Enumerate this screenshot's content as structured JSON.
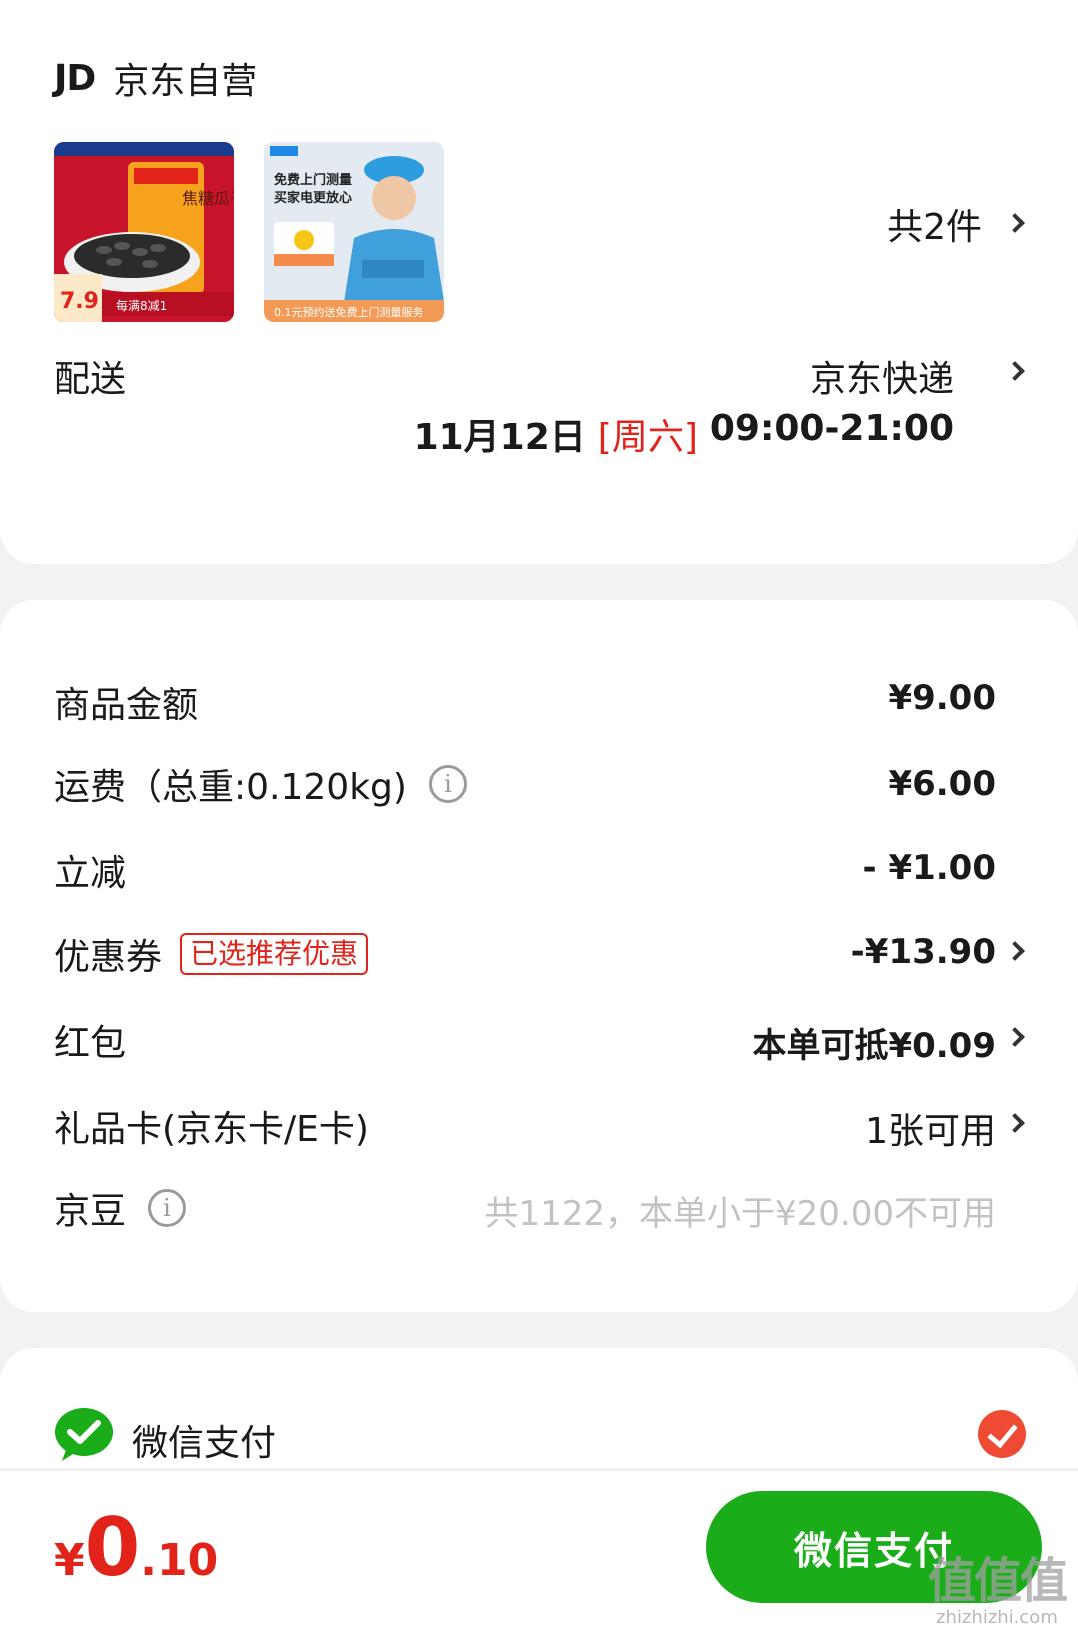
{
  "shop": {
    "logo_text": "JD",
    "name": "京东自营",
    "thumb1": {
      "price": "7.9",
      "promo": "每满8减1",
      "caption": "焦糖瓜子"
    },
    "thumb2": {
      "headline": "免费上门测量",
      "subline": "买家电更放心",
      "banner": "0.1元预约送免费上门测量服务"
    },
    "item_count": "共2件"
  },
  "delivery": {
    "label": "配送",
    "carrier": "京东快递",
    "date": "11月12日",
    "weekday": "[周六]",
    "time_window": "09:00-21:00"
  },
  "price_rows": {
    "goods": {
      "label": "商品金额",
      "value": "¥9.00"
    },
    "shipping": {
      "label": "运费（总重:0.120kg)",
      "value": "¥6.00"
    },
    "discount": {
      "label": "立减",
      "value": "- ¥1.00"
    },
    "coupon": {
      "label": "优惠券",
      "tag": "已选推荐优惠",
      "value": "-¥13.90"
    },
    "red_packet": {
      "label": "红包",
      "value": "本单可抵¥0.09"
    },
    "gift_card": {
      "label": "礼品卡(京东卡/E卡)",
      "value": "1张可用"
    },
    "jingdou": {
      "label": "京豆",
      "value": "共1122，本单小于¥20.00不可用"
    }
  },
  "payment": {
    "method": "微信支付",
    "selected": true
  },
  "footer": {
    "total_symbol": "¥",
    "total_integer": "0",
    "total_decimal": ".10",
    "pay_button": "微信支付",
    "watermark": "值值值",
    "watermark_url": "zhizhizhi.com"
  },
  "colors": {
    "accent_red": "#e2231a",
    "wechat_green": "#1aad19",
    "check_orange": "#ef4b34"
  }
}
